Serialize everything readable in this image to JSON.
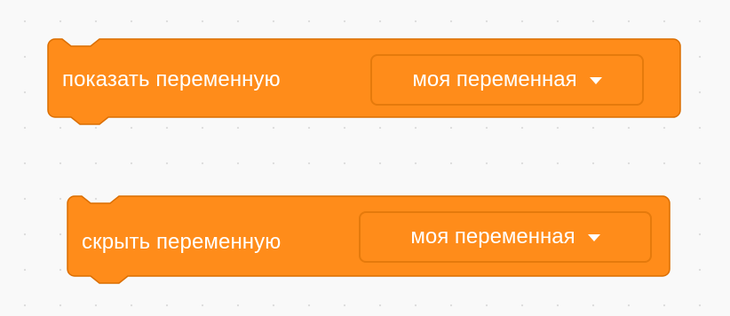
{
  "blocks": [
    {
      "label": "показать переменную",
      "dropdown": "моя переменная"
    },
    {
      "label": "скрыть переменную",
      "dropdown": "моя переменная"
    }
  ],
  "colors": {
    "block_fill": "#ff8c1a",
    "block_border": "#db6e00",
    "dropdown_border": "#e57a0c",
    "text": "#ffffff",
    "workspace": "#f9f9f9"
  },
  "icons": {
    "dropdown_arrow": "chevron-down-icon"
  }
}
